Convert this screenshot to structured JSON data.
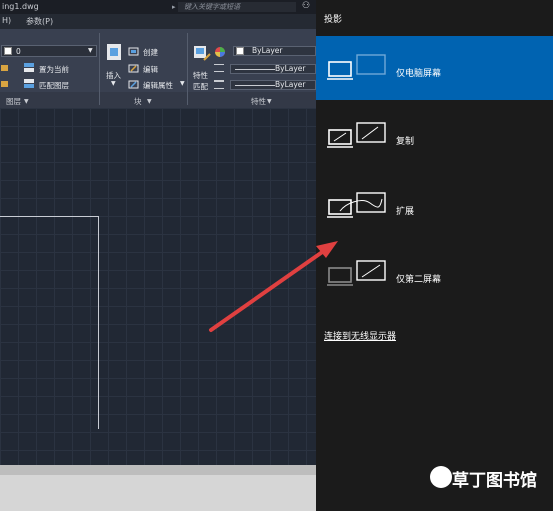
{
  "cad": {
    "title": "ing1.dwg",
    "search_placeholder": "键入关键字或短语",
    "menu": {
      "item1": "H)",
      "item2": "参数(P)"
    },
    "layer_value": "0",
    "layer_tools": {
      "set_current": "置为当前",
      "match_layer": "匹配图层"
    },
    "panels": {
      "layers": "图层",
      "block": "块",
      "properties": "特性"
    },
    "block": {
      "insert": "插入",
      "create": "创建",
      "edit": "编辑",
      "edit_attributes": "编辑属性"
    },
    "properties": {
      "match_line1": "特性",
      "match_line2": "匹配",
      "color": "ByLayer",
      "linetype": "ByLayer",
      "lineweight": "ByLayer"
    }
  },
  "project": {
    "title": "投影",
    "options": [
      {
        "label": "仅电脑屏幕",
        "icon": "pc-screen-only-icon",
        "selected": true
      },
      {
        "label": "复制",
        "icon": "duplicate-icon",
        "selected": false
      },
      {
        "label": "扩展",
        "icon": "extend-icon",
        "selected": false
      },
      {
        "label": "仅第二屏幕",
        "icon": "second-screen-only-icon",
        "selected": false
      }
    ],
    "connect_link": "连接到无线显示器"
  },
  "watermark": {
    "text": "草丁图书馆"
  },
  "colors": {
    "selected": "#0063b1",
    "panel_bg": "#1b1b1b",
    "arrow": "#e04040"
  }
}
